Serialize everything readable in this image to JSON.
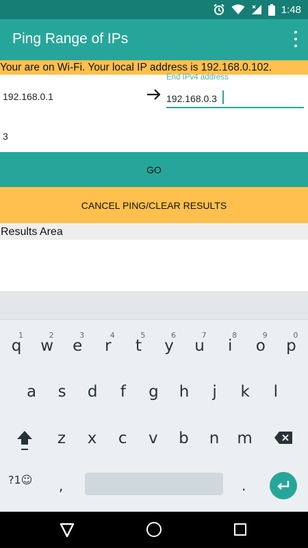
{
  "status_bar": {
    "time": "1:48"
  },
  "app_bar": {
    "title": "Ping Range of IPs"
  },
  "banner": {
    "text": "Your are on Wi-Fi. Your local IP address is 192.168.0.102."
  },
  "range": {
    "start_ip": "192.168.0.1",
    "end_label": "End IPv4 address",
    "end_ip": "192.168.0.3",
    "count": "3"
  },
  "buttons": {
    "go": "GO",
    "cancel": "CANCEL PING/CLEAR RESULTS"
  },
  "results": {
    "header": "Results Area"
  },
  "keyboard": {
    "row1": [
      {
        "k": "q",
        "h": "1"
      },
      {
        "k": "w",
        "h": "2"
      },
      {
        "k": "e",
        "h": "3"
      },
      {
        "k": "r",
        "h": "4"
      },
      {
        "k": "t",
        "h": "5"
      },
      {
        "k": "y",
        "h": "6"
      },
      {
        "k": "u",
        "h": "7"
      },
      {
        "k": "i",
        "h": "8"
      },
      {
        "k": "o",
        "h": "9"
      },
      {
        "k": "p",
        "h": "0"
      }
    ],
    "row2": [
      "a",
      "s",
      "d",
      "f",
      "g",
      "h",
      "j",
      "k",
      "l"
    ],
    "row3": [
      "z",
      "x",
      "c",
      "v",
      "b",
      "n",
      "m"
    ],
    "symbols": "?1☺",
    "comma": ",",
    "period": "."
  },
  "colors": {
    "primary": "#26a69a",
    "primary_dark": "#167e74",
    "accent": "#ffc04d"
  }
}
